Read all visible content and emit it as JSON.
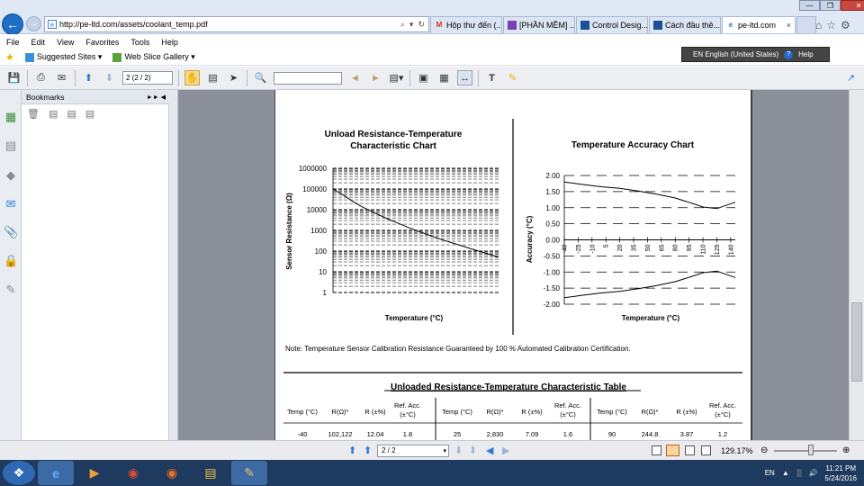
{
  "browser": {
    "url": "http://pe-ltd.com/assets/coolant_temp.pdf",
    "tabs": [
      {
        "label": "Hộp thư đến (..."
      },
      {
        "label": "[PHẦN MỀM] ..."
      },
      {
        "label": "Control Desig..."
      },
      {
        "label": "Cách đầu thê..."
      },
      {
        "label": "pe-ltd.com"
      }
    ],
    "menu": [
      "File",
      "Edit",
      "View",
      "Favorites",
      "Tools",
      "Help"
    ],
    "favorites": [
      "Suggested Sites ▾",
      "Web Slice Gallery ▾"
    ],
    "language": "EN English (United States)",
    "help": "Help"
  },
  "reader": {
    "page_indicator": "2 (2 / 2)",
    "bookmarks_title": "Bookmarks",
    "status_page": "2 / 2",
    "zoom": "129.17%"
  },
  "document": {
    "chart1_title_line1": "Unload Resistance-Temperature",
    "chart1_title_line2": "Characteristic Chart",
    "chart1_ylabel": "Sensor Resistance (Ω)",
    "chart1_xlabel": "Temperature (°C)",
    "chart2_title": "Temperature Accuracy Chart",
    "chart2_ylabel": "Accuracy (°C)",
    "chart2_xlabel": "Temperature (°C)",
    "note": "Note: Temperature Sensor Calibration Resistance Guaranteed by 100 % Automated Calibration Certification.",
    "table_title": "Unloaded Resistance-Temperature Characteristic Table",
    "table_headers": [
      "Temp (°C)",
      "R(Ω)*",
      "R (±%)",
      "Ref. Acc. (±°C)",
      "Temp (°C)",
      "R(Ω)*",
      "R (±%)",
      "Ref. Acc. (±°C)",
      "Temp (°C)",
      "R(Ω)*",
      "R (±%)",
      "Ref. Acc. (±°C)"
    ],
    "table_row": [
      "-40",
      "102,122",
      "12.04",
      "1.8",
      "25",
      "2,830",
      "7.09",
      "1.6",
      "90",
      "244.8",
      "3.87",
      "1.2"
    ]
  },
  "chart_data": [
    {
      "type": "line",
      "title": "Unload Resistance-Temperature Characteristic Chart",
      "xlabel": "Temperature (°C)",
      "ylabel": "Sensor Resistance (Ω)",
      "yscale": "log",
      "ylim": [
        1,
        1000000
      ],
      "yticks": [
        "1",
        "10",
        "100",
        "1000",
        "10000",
        "100000",
        "1000000"
      ],
      "grid": true,
      "series": [
        {
          "x": [
            -40,
            -30,
            -20,
            -10,
            0,
            10,
            20,
            25,
            30,
            40,
            50,
            60,
            70,
            80,
            90,
            100,
            110,
            120,
            130,
            140
          ],
          "values": [
            100000,
            55000,
            28000,
            15000,
            9000,
            5600,
            3500,
            2830,
            2300,
            1500,
            1000,
            700,
            480,
            340,
            245,
            180,
            130,
            95,
            70,
            50
          ]
        }
      ]
    },
    {
      "type": "line",
      "title": "Temperature Accuracy Chart",
      "xlabel": "Temperature (°C)",
      "ylabel": "Accuracy (°C)",
      "ylim": [
        -2.0,
        2.0
      ],
      "yticks": [
        "2.00",
        "1.50",
        "1.00",
        "0.50",
        "0.00",
        "-0.50",
        "-1.00",
        "-1.50",
        "-2.00"
      ],
      "xticks": [
        "-40",
        "-25",
        "-10",
        "5",
        "20",
        "35",
        "50",
        "65",
        "80",
        "95",
        "110",
        "125",
        "140"
      ],
      "grid": true,
      "series": [
        {
          "x": [
            -40,
            -20,
            0,
            20,
            40,
            60,
            80,
            100,
            110,
            125,
            135,
            145
          ],
          "values": [
            1.8,
            1.72,
            1.65,
            1.6,
            1.52,
            1.42,
            1.3,
            1.12,
            1.02,
            0.97,
            1.07,
            1.17
          ]
        },
        {
          "x": [
            -40,
            -20,
            0,
            20,
            40,
            60,
            80,
            100,
            110,
            125,
            135,
            145
          ],
          "values": [
            -1.8,
            -1.72,
            -1.65,
            -1.6,
            -1.52,
            -1.42,
            -1.3,
            -1.12,
            -1.02,
            -0.97,
            -1.07,
            -1.17
          ]
        }
      ]
    }
  ],
  "system": {
    "time": "11:21 PM",
    "date": "5/24/2016"
  }
}
